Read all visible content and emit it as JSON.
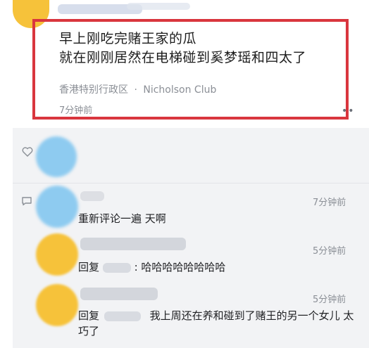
{
  "post": {
    "line1": "早上刚吃完赌王家的瓜",
    "line2": "就在刚刚居然在电梯碰到奚梦瑶和四太了",
    "location": "香港特别行政区",
    "separator": "·",
    "venue": "Nicholson Club",
    "time": "7分钟前",
    "more": "••"
  },
  "comments": [
    {
      "text": "重新评论一遍 天啊",
      "time": "7分钟前"
    },
    {
      "prefix": "回复",
      "text": ": 哈哈哈哈哈哈哈哈",
      "time": "5分钟前"
    },
    {
      "prefix": "回复",
      "text": "我上周还在养和碰到了赌王的另一个女儿 太巧了",
      "time": "5分钟前"
    }
  ],
  "icons": {
    "like": "heart-outline-icon",
    "comment": "comment-bubble-icon"
  },
  "colors": {
    "highlight_border": "#d9363e",
    "avatar": "#f6c23a",
    "avatar_blur": "#8ecbf0"
  }
}
